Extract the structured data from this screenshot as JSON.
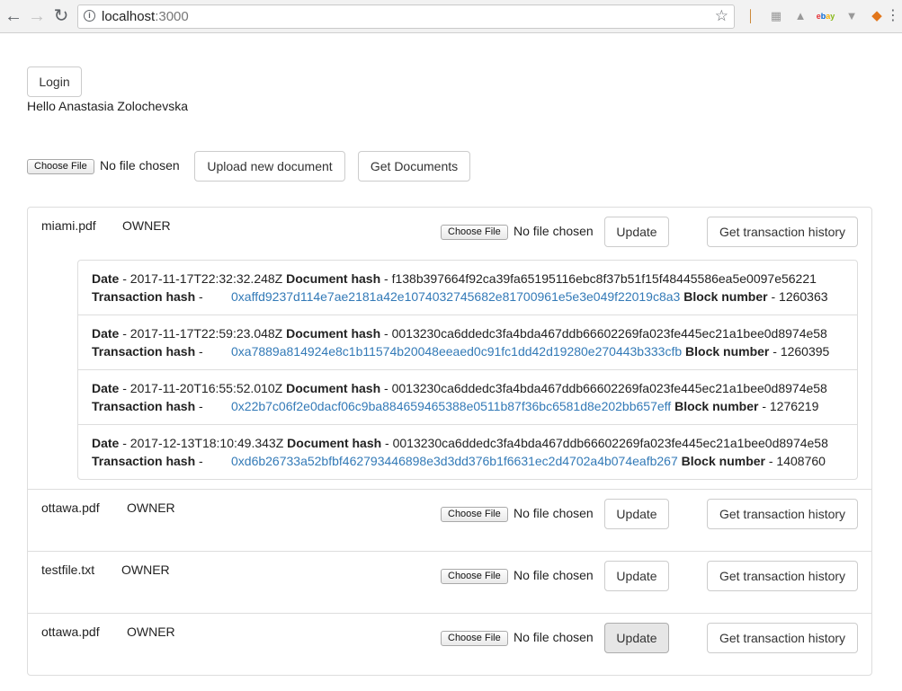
{
  "browser": {
    "url_host": "localhost",
    "url_port": ":3000",
    "icons": [
      "back-icon",
      "forward-icon",
      "reload-icon",
      "info-icon",
      "star-icon"
    ]
  },
  "header": {
    "login_label": "Login",
    "greeting": "Hello Anastasia Zolochevska"
  },
  "upload": {
    "choose_file_label": "Choose File",
    "no_file_text": "No file chosen",
    "upload_label": "Upload new document",
    "get_documents_label": "Get Documents"
  },
  "documents": [
    {
      "name": "miami.pdf",
      "role": "OWNER",
      "choose_file_label": "Choose File",
      "no_file_text": "No file chosen",
      "update_label": "Update",
      "history_label": "Get transaction history",
      "transactions": [
        {
          "date_label": "Date",
          "date": " - 2017-11-17T22:32:32.248Z ",
          "doc_hash_label": "Document hash",
          "doc_hash": " - f138b397664f92ca39fa65195116ebc8f37b51f15f48445586ea5e0097e56221",
          "tx_hash_label": "Transaction hash",
          "tx_sep": " - ",
          "tx_hash": "0xaffd9237d114e7ae2181a42e1074032745682e81700961e5e3e049f22019c8a3",
          "block_label": "Block number",
          "block": " - 1260363"
        },
        {
          "date_label": "Date",
          "date": " - 2017-11-17T22:59:23.048Z ",
          "doc_hash_label": "Document hash",
          "doc_hash": " - 0013230ca6ddedc3fa4bda467ddb66602269fa023fe445ec21a1bee0d8974e58",
          "tx_hash_label": "Transaction hash",
          "tx_sep": " - ",
          "tx_hash": "0xa7889a814924e8c1b11574b20048eeaed0c91fc1dd42d19280e270443b333cfb",
          "block_label": "Block number",
          "block": " - 1260395"
        },
        {
          "date_label": "Date",
          "date": " - 2017-11-20T16:55:52.010Z ",
          "doc_hash_label": "Document hash",
          "doc_hash": " - 0013230ca6ddedc3fa4bda467ddb66602269fa023fe445ec21a1bee0d8974e58",
          "tx_hash_label": "Transaction hash",
          "tx_sep": " - ",
          "tx_hash": "0x22b7c06f2e0dacf06c9ba884659465388e0511b87f36bc6581d8e202bb657eff",
          "block_label": "Block number",
          "block": " - 1276219"
        },
        {
          "date_label": "Date",
          "date": " - 2017-12-13T18:10:49.343Z ",
          "doc_hash_label": "Document hash",
          "doc_hash": " - 0013230ca6ddedc3fa4bda467ddb66602269fa023fe445ec21a1bee0d8974e58",
          "tx_hash_label": "Transaction hash",
          "tx_sep": " - ",
          "tx_hash": "0xd6b26733a52bfbf462793446898e3d3dd376b1f6631ec2d4702a4b074eafb267",
          "block_label": "Block number",
          "block": " - 1408760"
        }
      ]
    },
    {
      "name": "ottawa.pdf",
      "role": "OWNER",
      "choose_file_label": "Choose File",
      "no_file_text": "No file chosen",
      "update_label": "Update",
      "history_label": "Get transaction history"
    },
    {
      "name": "testfile.txt",
      "role": "OWNER",
      "choose_file_label": "Choose File",
      "no_file_text": "No file chosen",
      "update_label": "Update",
      "history_label": "Get transaction history"
    },
    {
      "name": "ottawa.pdf",
      "role": "OWNER",
      "choose_file_label": "Choose File",
      "no_file_text": "No file chosen",
      "update_label": "Update",
      "history_label": "Get transaction history"
    }
  ]
}
